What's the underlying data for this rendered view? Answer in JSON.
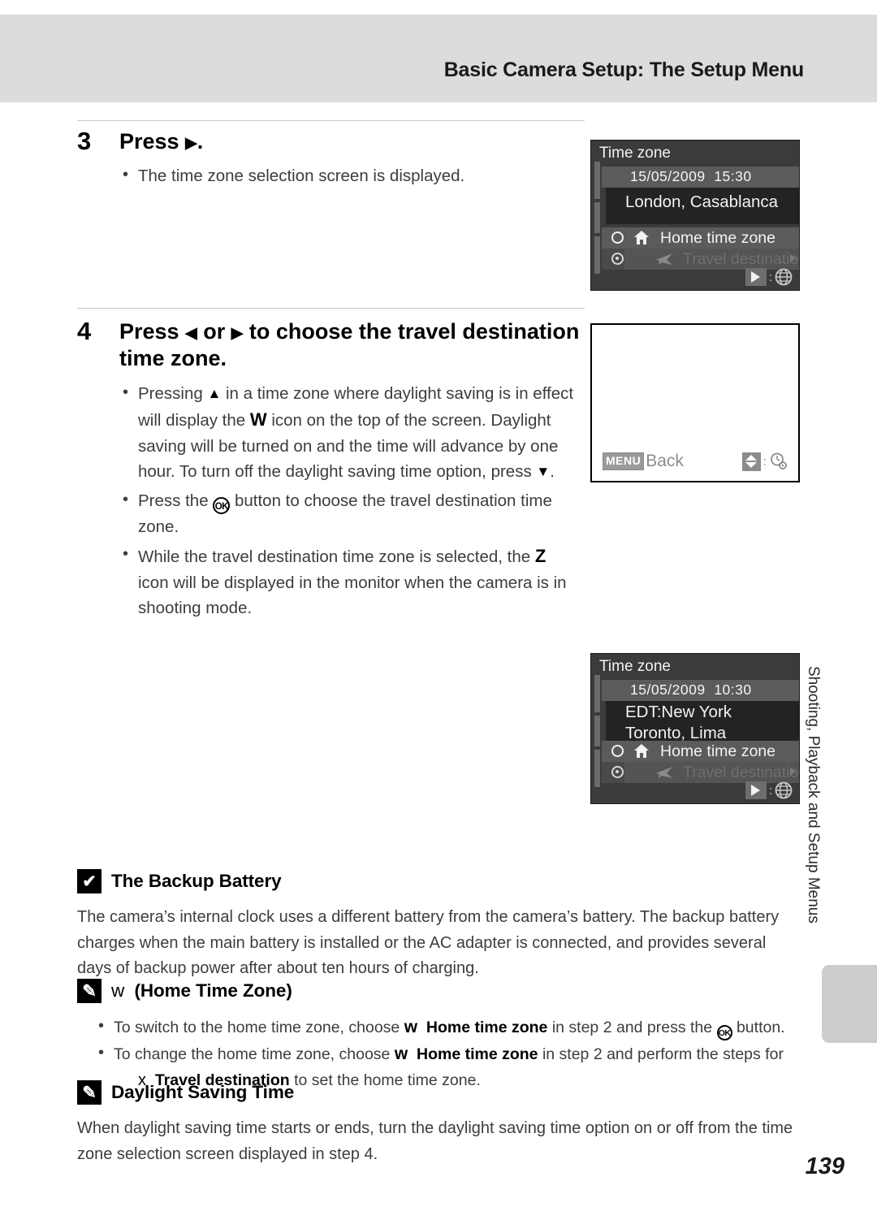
{
  "header": {
    "title": "Basic Camera Setup: The Setup Menu"
  },
  "steps": [
    {
      "number": "3",
      "heading_pre": "Press ",
      "heading_post": ".",
      "bullets": [
        {
          "text": "The time zone selection screen is displayed."
        }
      ]
    },
    {
      "number": "4",
      "heading_line1_a": "Press ",
      "heading_line1_b": " or ",
      "heading_line1_c": " to choose the travel destination",
      "heading_line2": "time zone.",
      "bullets": [
        {
          "a": "Pressing ",
          "b": " in a time zone where daylight saving is in effect will display the ",
          "c": "W",
          "d": " icon on the top of the screen. Daylight saving will be turned on and the time will advance by one hour. To turn off the daylight saving time option, press ",
          "e": "."
        },
        {
          "a": "Press the ",
          "b": "OK",
          "c": " button to choose the travel destination time zone."
        },
        {
          "a": "While the travel destination time zone is selected, the ",
          "b": "Z",
          "c": " icon will be displayed in the monitor when the camera is in shooting mode."
        }
      ]
    }
  ],
  "screens": [
    {
      "id": "time-zone-london",
      "title": "Time zone",
      "date": "15/05/2009",
      "time": "15:30",
      "zone_lines": [
        "London, Casablanca"
      ],
      "home_label": "Home time zone",
      "travel_label": "Travel destination",
      "hint_icon": "play-globe"
    },
    {
      "id": "blank-menu-back",
      "menu_chip": "MENU",
      "back_label": "Back",
      "hint_icon": "updown-clock"
    },
    {
      "id": "time-zone-newyork",
      "title": "Time zone",
      "date": "15/05/2009",
      "time": "10:30",
      "zone_lines": [
        "EDT:New York",
        "Toronto, Lima"
      ],
      "home_label": "Home time zone",
      "travel_label": "Travel destination",
      "hint_icon": "play-globe"
    }
  ],
  "side_tab": {
    "label": "Shooting, Playback and Setup Menus"
  },
  "notes": [
    {
      "icon": "caution-check-icon",
      "icon_glyph": "✔",
      "title": "The Backup Battery",
      "body": "The camera’s internal clock uses a different battery from the camera’s battery. The backup battery charges when the main battery is installed or the AC adapter is connected, and provides several days of backup power after about ten hours of charging."
    },
    {
      "icon": "pencil-note-icon",
      "icon_glyph": "✎",
      "title_sym": "w",
      "title": "(Home Time Zone)",
      "bullets": [
        {
          "a": "To switch to the home time zone, choose ",
          "sym": "w",
          "b": "Home time zone",
          "c": " in step 2 and press the ",
          "ok": "OK",
          "d": " button."
        },
        {
          "a": "To change the home time zone, choose ",
          "sym": "w",
          "b": "Home time zone",
          "c": " in step 2 and perform the steps for"
        }
      ],
      "sub_sym": "x",
      "sub_bold": "Travel destination",
      "sub_rest": " to set the home time zone."
    },
    {
      "icon": "pencil-note-icon",
      "icon_glyph": "✎",
      "title": "Daylight Saving Time",
      "body": "When daylight saving time starts or ends, turn the daylight saving time option on or off from the time zone selection screen displayed in step 4."
    }
  ],
  "page_number": "139"
}
